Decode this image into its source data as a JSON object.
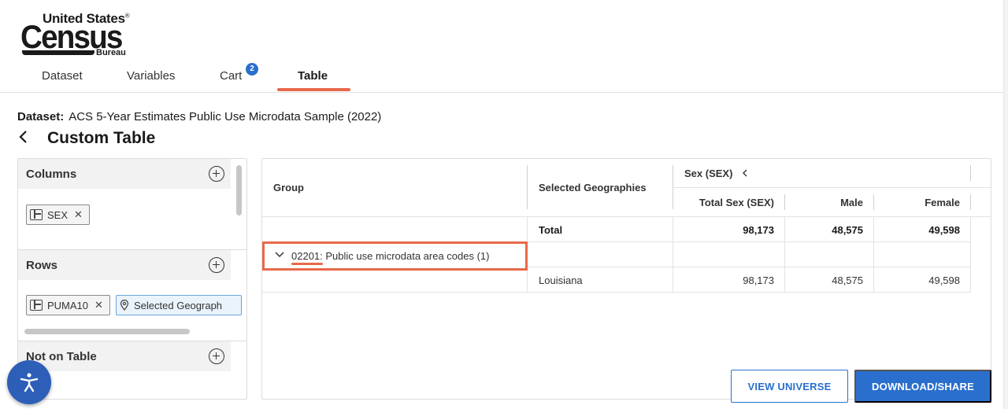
{
  "logo": {
    "line1": "United States",
    "reg": "®",
    "line2": "Census",
    "line3": "Bureau"
  },
  "nav": {
    "tabs": [
      {
        "label": "Dataset"
      },
      {
        "label": "Variables"
      },
      {
        "label": "Cart"
      },
      {
        "label": "Table"
      }
    ],
    "cart_count": "2",
    "active_tab": "Table"
  },
  "dataset": {
    "label": "Dataset:",
    "value": "ACS 5-Year Estimates Public Use Microdata Sample (2022)"
  },
  "page_title": "Custom Table",
  "left_panel": {
    "columns": {
      "title": "Columns",
      "chips": [
        {
          "label": "SEX"
        }
      ]
    },
    "rows": {
      "title": "Rows",
      "chips": [
        {
          "label": "PUMA10"
        },
        {
          "label": "Selected Geograph"
        }
      ]
    },
    "not_on_table": {
      "title": "Not on Table"
    }
  },
  "table": {
    "headers": {
      "group": "Group",
      "geo": "Selected Geographies",
      "sex_group": "Sex (SEX)",
      "total": "Total Sex (SEX)",
      "male": "Male",
      "female": "Female"
    },
    "total_row": {
      "label": "Total",
      "total": "98,173",
      "male": "48,575",
      "female": "49,598"
    },
    "group_row": {
      "code": "02201",
      "text": ": Public use microdata area codes (1)"
    },
    "geo_row": {
      "label": "Louisiana",
      "total": "98,173",
      "male": "48,575",
      "female": "49,598"
    }
  },
  "buttons": {
    "view_universe": "VIEW UNIVERSE",
    "download": "DOWNLOAD/SHARE"
  },
  "colors": {
    "accent": "#e8694a",
    "primary": "#2a6fce",
    "a11y": "#2d5fb8"
  }
}
